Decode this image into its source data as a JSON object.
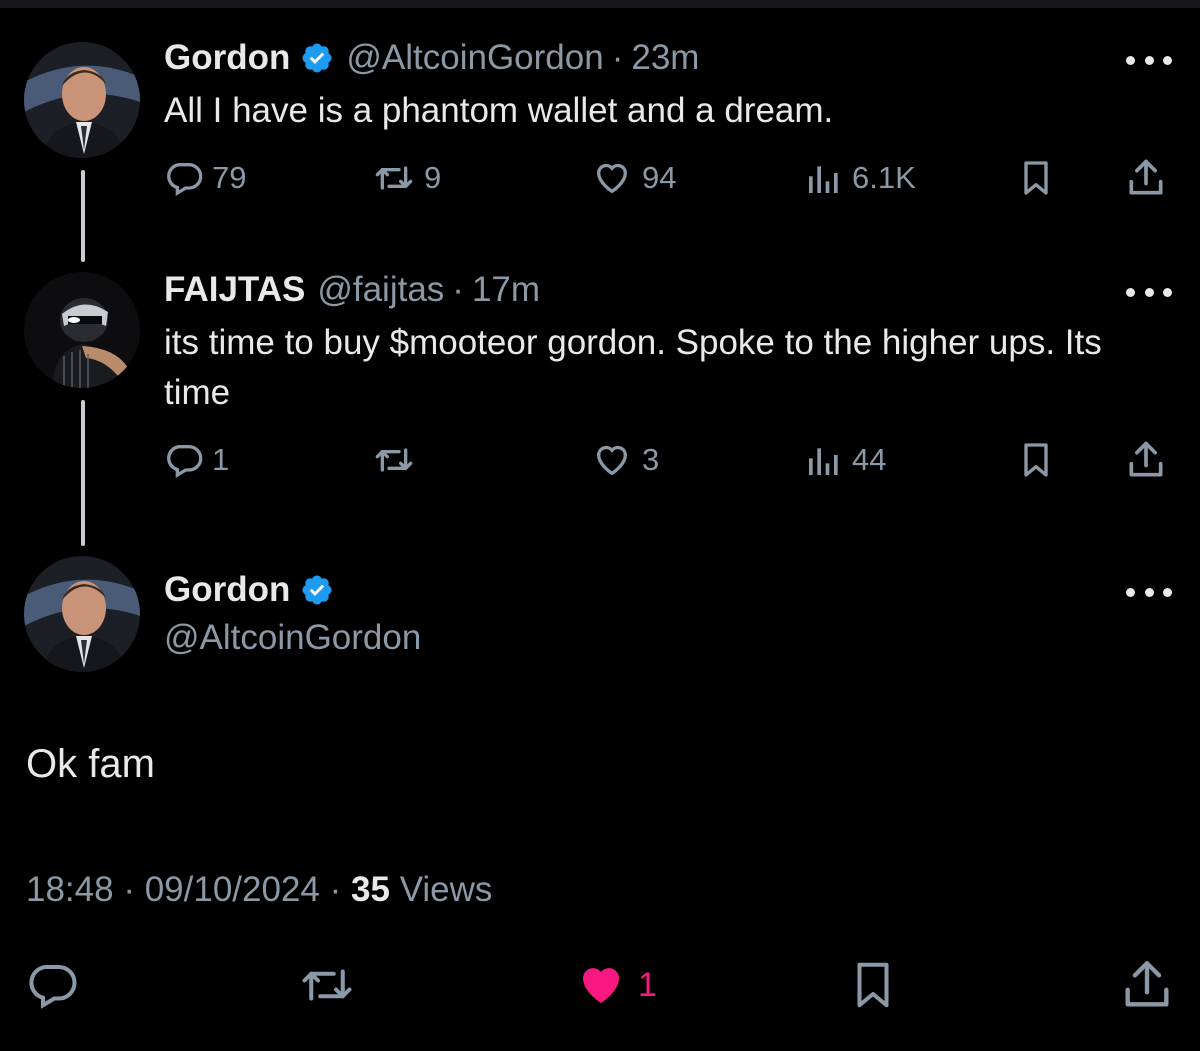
{
  "tweets": [
    {
      "name": "Gordon",
      "handle": "@AltcoinGordon",
      "time": "23m",
      "text": "All I have is a phantom wallet and a dream.",
      "replies": "79",
      "retweets": "9",
      "likes": "94",
      "views": "6.1K",
      "verified": true
    },
    {
      "name": "FAIJTAS",
      "handle": "@faijtas",
      "time": "17m",
      "text": "its time to buy $mooteor gordon. Spoke to the higher ups. Its time",
      "replies": "1",
      "retweets": "",
      "likes": "3",
      "views": "44",
      "verified": false
    }
  ],
  "main": {
    "name": "Gordon",
    "handle": "@AltcoinGordon",
    "text": "Ok fam",
    "time": "18:48",
    "date": "09/10/2024",
    "views_count": "35",
    "views_label": "Views",
    "likes": "1"
  },
  "colors": {
    "background": "#000000",
    "text": "#e7e9ea",
    "muted": "#8b98a5",
    "verified": "#1d9bf0",
    "like": "#f91880"
  },
  "icons": [
    "reply-icon",
    "retweet-icon",
    "like-icon",
    "views-icon",
    "bookmark-icon",
    "share-icon",
    "more-icon",
    "verified-icon"
  ]
}
